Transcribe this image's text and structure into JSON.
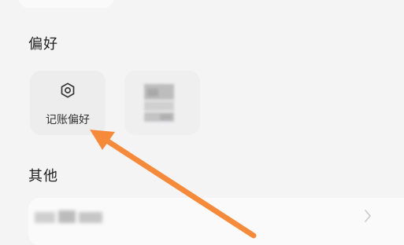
{
  "sections": {
    "preferences_title": "偏好",
    "other_title": "其他"
  },
  "preferences": {
    "items": [
      {
        "label": "记账偏好",
        "icon": "gear-icon"
      }
    ]
  },
  "colors": {
    "annotation_arrow": "#f58a3b"
  }
}
